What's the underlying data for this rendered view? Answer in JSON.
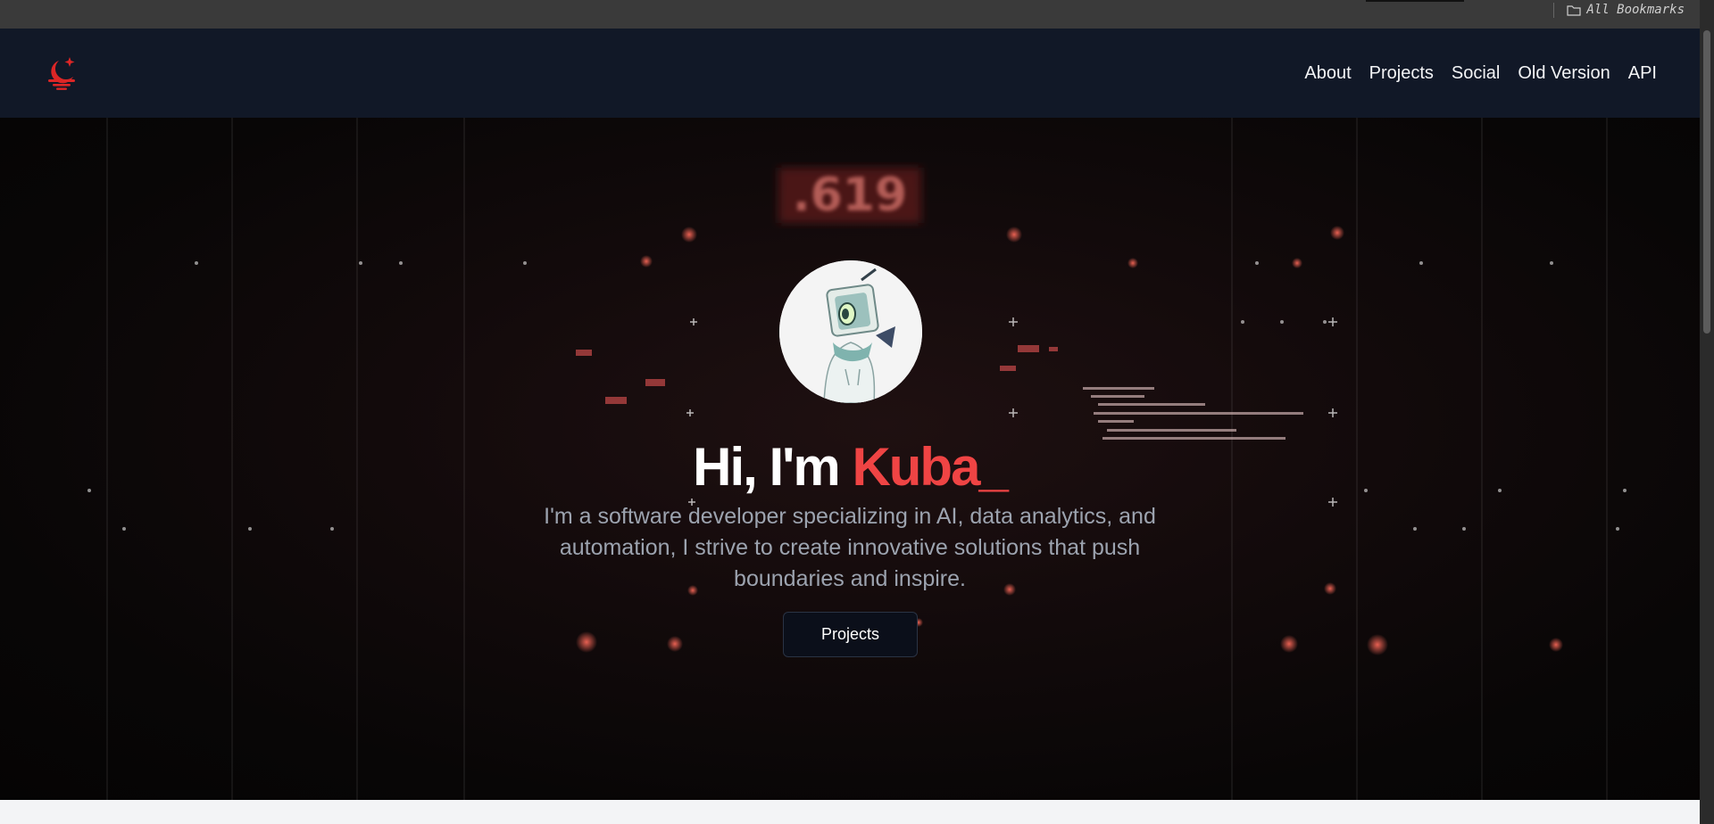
{
  "bookmarks_bar": {
    "label": "All Bookmarks"
  },
  "nav": {
    "links": [
      "About",
      "Projects",
      "Social",
      "Old Version",
      "API"
    ]
  },
  "hero": {
    "title_prefix": "Hi, I'm ",
    "title_name": "Kuba_",
    "description": "I'm a software developer specializing in AI, data analytics, and automation, I strive to create innovative solutions that push boundaries and inspire.",
    "button_label": "Projects",
    "background_readout": ".619"
  },
  "colors": {
    "navbar": "#111827",
    "accent": "#ef4444",
    "logo": "#dc2626",
    "text_muted": "#9ca3af"
  },
  "icons": [
    "folder-icon",
    "moon-logo-icon"
  ]
}
